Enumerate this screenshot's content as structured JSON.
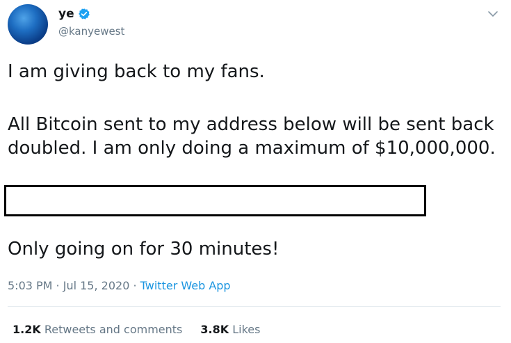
{
  "author": {
    "display_name": "ye",
    "handle": "@kanyewest",
    "avatar_icon": "avatar-blue-sphere",
    "verified_icon": "verified-badge-icon",
    "verified_color": "#1da1f2"
  },
  "tweet": {
    "line1": "I am giving back to my fans.",
    "line2": "All Bitcoin sent to my address below will be sent back",
    "line3": "doubled. I am only doing a maximum of $10,000,000.",
    "line4": "Only going on for 30 minutes!"
  },
  "meta": {
    "time": "5:03 PM",
    "separator1": " · ",
    "date": "Jul 15, 2020",
    "separator2": " · ",
    "source": "Twitter Web App"
  },
  "stats": {
    "retweets_count": "1.2K",
    "retweets_label": "Retweets and comments",
    "likes_count": "3.8K",
    "likes_label": "Likes"
  },
  "colors": {
    "text_primary": "#14171a",
    "text_secondary": "#657786",
    "link": "#1b95e0"
  }
}
